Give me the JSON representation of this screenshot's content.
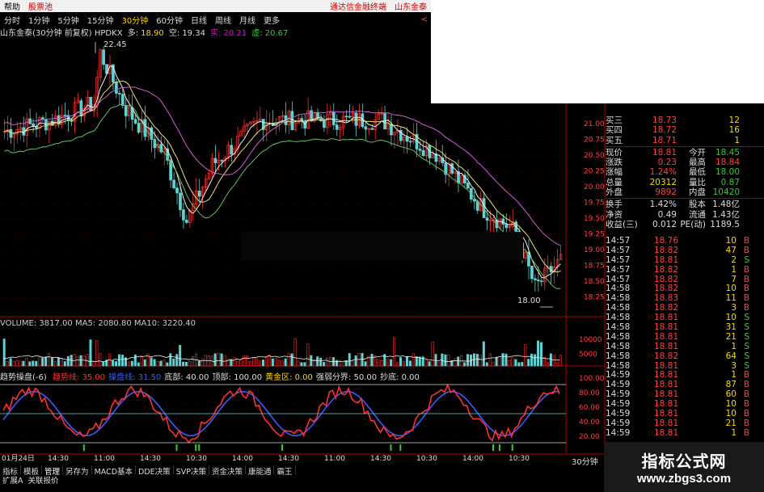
{
  "menubar": {
    "items": [
      "帮助",
      "股票池"
    ],
    "links": [
      "通达信金融终端",
      "山东金泰"
    ]
  },
  "timeframes": {
    "items": [
      "分时",
      "1分钟",
      "5分钟",
      "15分钟",
      "30分钟",
      "60分钟",
      "日线",
      "周线",
      "月线",
      "更多"
    ],
    "active_index": 4,
    "close": "<"
  },
  "info": {
    "title": "山东金泰(30分钟 前复权) HPDKX",
    "duo_label": "多:",
    "duo": "18.90",
    "kong_label": "空:",
    "kong": "19.34",
    "shi_label": "实:",
    "shi": "20.21",
    "xu_label": "虚:",
    "xu": "20.67"
  },
  "price_axis": {
    "labels": [
      "21.00",
      "20.75",
      "20.50",
      "20.25",
      "20.00",
      "19.75",
      "19.50",
      "19.25",
      "19.00",
      "18.75",
      "18.50",
      "18.25"
    ]
  },
  "annotations": {
    "high": "22.45",
    "low": "18.00"
  },
  "volume": {
    "label": "VOLUME: 3817.00",
    "ma5": "MA5: 2080.80",
    "ma10": "MA10: 3220.40",
    "axis": [
      "10000",
      "5000"
    ]
  },
  "indicator": {
    "title": "趋势操盘(-6)",
    "items": [
      {
        "k": "趋势线: 35.00",
        "c": "#ff3030"
      },
      {
        "k": "操盘线: 31.50",
        "c": "#3a5cff"
      },
      {
        "k": "底部: 40.00",
        "c": "#ddd"
      },
      {
        "k": "顶部: 100.00",
        "c": "#ddd"
      },
      {
        "k": "黄金区: 0.00",
        "c": "#ffd800"
      },
      {
        "k": "强弱分界: 50.00",
        "c": "#ddd"
      },
      {
        "k": "抄底: 0.00",
        "c": "#ddd"
      }
    ],
    "axis": [
      "100.00",
      "80.00",
      "60.00",
      "40.00",
      "20.00"
    ]
  },
  "time_axis": [
    "01月24日",
    "14:30",
    "11:00",
    "14:30",
    "10:30",
    "14:00",
    "14:30",
    "11:00",
    "14:30",
    "10:30",
    "14:00",
    "10:30"
  ],
  "quote": {
    "book": [
      {
        "label": "买三",
        "price": "18.73",
        "vol": "12"
      },
      {
        "label": "买四",
        "price": "18.72",
        "vol": "16"
      },
      {
        "label": "买五",
        "price": "18.71",
        "vol": "1"
      }
    ],
    "stats": [
      {
        "a": "现价",
        "b": "18.81",
        "bc": "#ff4040",
        "c": "今开",
        "d": "18.45",
        "dc": "#3c3"
      },
      {
        "a": "涨跌",
        "b": "0.23",
        "bc": "#ff4040",
        "c": "最高",
        "d": "18.84",
        "dc": "#ff4040"
      },
      {
        "a": "涨幅",
        "b": "1.24%",
        "bc": "#ff4040",
        "c": "最低",
        "d": "18.00",
        "dc": "#3c3"
      },
      {
        "a": "总量",
        "b": "20312",
        "bc": "#ffd800",
        "c": "量比",
        "d": "0.87",
        "dc": "#3c3"
      },
      {
        "a": "外盘",
        "b": "9892",
        "bc": "#ff4040",
        "c": "内盘",
        "d": "10420",
        "dc": "#3c3"
      },
      {
        "a": "换手",
        "b": "1.42%",
        "bc": "#ddd",
        "c": "股本",
        "d": "1.48亿",
        "dc": "#ddd"
      },
      {
        "a": "净资",
        "b": "0.49",
        "bc": "#ddd",
        "c": "流通",
        "d": "1.43亿",
        "dc": "#ddd"
      },
      {
        "a": "收益(三)",
        "b": "0.012",
        "bc": "#ddd",
        "c": "PE(动)",
        "d": "1189.5",
        "dc": "#ddd"
      }
    ]
  },
  "ticks": [
    {
      "t": "14:57",
      "p": "18.76",
      "v": "10",
      "s": "B"
    },
    {
      "t": "14:57",
      "p": "18.82",
      "v": "47",
      "s": "B"
    },
    {
      "t": "14:57",
      "p": "18.81",
      "v": "2",
      "s": "S"
    },
    {
      "t": "14:57",
      "p": "18.82",
      "v": "1",
      "s": "B"
    },
    {
      "t": "14:57",
      "p": "18.82",
      "v": "7",
      "s": "B"
    },
    {
      "t": "14:58",
      "p": "18.82",
      "v": "10",
      "s": "B"
    },
    {
      "t": "14:58",
      "p": "18.83",
      "v": "11",
      "s": "B"
    },
    {
      "t": "14:58",
      "p": "18.82",
      "v": "3",
      "s": "B"
    },
    {
      "t": "14:58",
      "p": "18.81",
      "v": "10",
      "s": "S"
    },
    {
      "t": "14:58",
      "p": "18.81",
      "v": "31",
      "s": "S"
    },
    {
      "t": "14:58",
      "p": "18.81",
      "v": "21",
      "s": "S"
    },
    {
      "t": "14:58",
      "p": "18.81",
      "v": "1",
      "s": "S"
    },
    {
      "t": "14:58",
      "p": "18.82",
      "v": "64",
      "s": "S"
    },
    {
      "t": "14:58",
      "p": "18.81",
      "v": "3",
      "s": "S"
    },
    {
      "t": "14:59",
      "p": "18.81",
      "v": "1",
      "s": "B"
    },
    {
      "t": "14:59",
      "p": "18.81",
      "v": "87",
      "s": "B"
    },
    {
      "t": "14:59",
      "p": "18.81",
      "v": "60",
      "s": "B"
    },
    {
      "t": "14:59",
      "p": "18.81",
      "v": "10",
      "s": "B"
    },
    {
      "t": "14:59",
      "p": "18.81",
      "v": "10",
      "s": "B"
    },
    {
      "t": "14:59",
      "p": "18.81",
      "v": "21",
      "s": "B"
    },
    {
      "t": "14:59",
      "p": "18.81",
      "v": "1",
      "s": "B"
    }
  ],
  "tf_bottom": "30分钟",
  "toolbar": [
    "指标",
    "模板",
    "管理",
    "另存为",
    "MACD基本",
    "DDE决策",
    "SVP决策",
    "资金决策",
    "康能通",
    "霸王"
  ],
  "toolbar2": [
    "扩展A",
    "关联报价"
  ],
  "logo": {
    "cn": "指标公式网",
    "url": "www.zbgs3.com"
  },
  "colors": {
    "up": "#ff3030",
    "down": "#5fd3d3",
    "ma1": "#eeeeee",
    "ma2": "#e8e070",
    "ma3": "#d060d0",
    "ma4": "#60c060",
    "grid": "#8b0000",
    "bg": "#000000"
  }
}
